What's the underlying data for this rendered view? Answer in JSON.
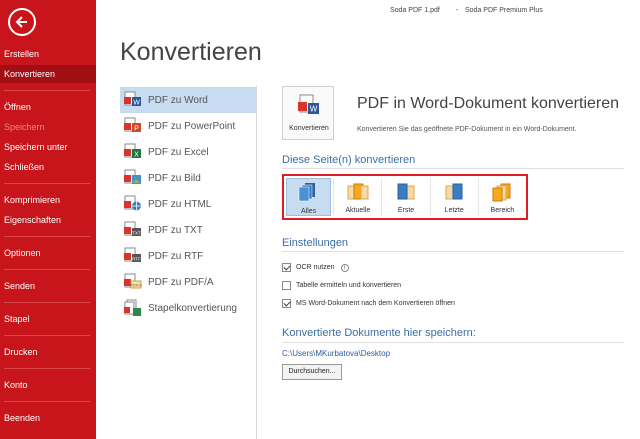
{
  "window": {
    "document_name": "Soda PDF 1.pdf",
    "app_name": "Soda PDF Premium Plus",
    "separator": "-"
  },
  "sidebar": {
    "items": [
      {
        "label": "Erstellen"
      },
      {
        "label": "Konvertieren"
      },
      {
        "label": "Öffnen"
      },
      {
        "label": "Speichern"
      },
      {
        "label": "Speichern unter"
      },
      {
        "label": "Schließen"
      },
      {
        "label": "Komprimieren"
      },
      {
        "label": "Eigenschaften"
      },
      {
        "label": "Optionen"
      },
      {
        "label": "Senden"
      },
      {
        "label": "Stapel"
      },
      {
        "label": "Drucken"
      },
      {
        "label": "Konto"
      },
      {
        "label": "Beenden"
      }
    ]
  },
  "page": {
    "title": "Konvertieren"
  },
  "conversions": [
    {
      "label": "PDF zu Word",
      "icon": "word-icon"
    },
    {
      "label": "PDF zu PowerPoint",
      "icon": "powerpoint-icon"
    },
    {
      "label": "PDF zu Excel",
      "icon": "excel-icon"
    },
    {
      "label": "PDF zu Bild",
      "icon": "image-icon"
    },
    {
      "label": "PDF zu HTML",
      "icon": "html-icon"
    },
    {
      "label": "PDF zu TXT",
      "icon": "txt-icon"
    },
    {
      "label": "PDF zu RTF",
      "icon": "rtf-icon"
    },
    {
      "label": "PDF zu PDF/A",
      "icon": "pdfa-icon"
    },
    {
      "label": "Stapelkonvertierung",
      "icon": "batch-icon"
    }
  ],
  "panel": {
    "button_label": "Konvertieren",
    "title": "PDF in Word-Dokument konvertieren",
    "description": "Konvertieren Sie das geöffnete PDF-Dokument in ein Word-Dokument."
  },
  "pages_section": {
    "title": "Diese Seite(n) konvertieren",
    "options": [
      {
        "label": "Alles"
      },
      {
        "label": "Aktuelle"
      },
      {
        "label": "Erste"
      },
      {
        "label": "Letzte"
      },
      {
        "label": "Bereich"
      }
    ]
  },
  "settings": {
    "title": "Einstellungen",
    "ocr": {
      "label": "OCR nutzen",
      "checked": true
    },
    "table": {
      "label": "Tabelle ermitteln und konvertieren",
      "checked": false
    },
    "open_after": {
      "label": "MS Word-Dokument nach dem Konvertieren öffnen",
      "checked": true
    }
  },
  "save": {
    "title": "Konvertierte Dokumente hier speichern:",
    "path": "C:\\Users\\MKurbatova\\Desktop",
    "browse_label": "Durchsuchen..."
  },
  "colors": {
    "sidebar_bg": "#c8151b",
    "sidebar_active": "#a10f15",
    "accent_blue": "#3a6ea5",
    "highlight": "#e01b24",
    "selection": "#c7dcf0"
  }
}
